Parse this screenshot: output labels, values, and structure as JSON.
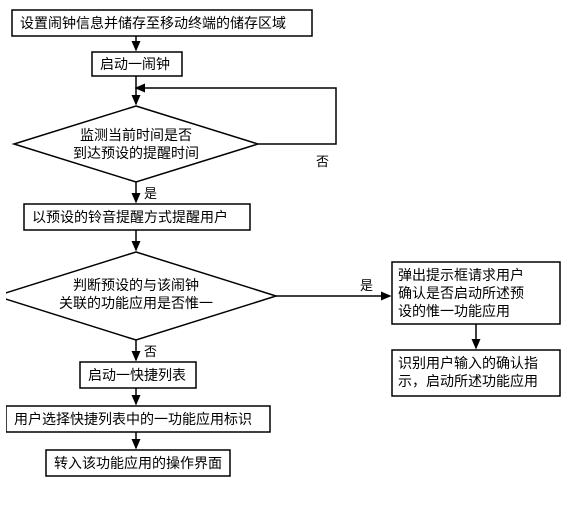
{
  "flow": {
    "step1": "设置闹钟信息并储存至移动终端的储存区域",
    "step2": "启动一闹钟",
    "decision1_line1": "监测当前时间是否",
    "decision1_line2": "到达预设的提醒时间",
    "decision1_yes": "是",
    "decision1_no": "否",
    "step3": "以预设的铃音提醒方式提醒用户",
    "decision2_line1": "判断预设的与该闹钟",
    "decision2_line2": "关联的功能应用是否惟一",
    "decision2_yes": "是",
    "decision2_no": "否",
    "step4": "启动一快捷列表",
    "step5": "用户选择快捷列表中的一功能应用标识",
    "step6": "转入该功能应用的操作界面",
    "branch1_line1": "弹出提示框请求用户",
    "branch1_line2": "确认是否启动所述预",
    "branch1_line3": "设的惟一功能应用",
    "branch2_line1": "识别用户输入的确认指",
    "branch2_line2": "示，启动所述功能应用"
  }
}
